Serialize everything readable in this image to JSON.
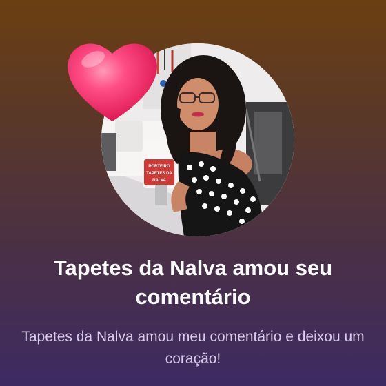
{
  "notification": {
    "title": "Tapetes da Nalva amou seu comentário",
    "message": "Tapetes da Nalva amou meu comentário e deixou um coração!"
  },
  "sewing_machine_sticker": {
    "line1": "PORTEIRO",
    "line2": "TAPETES DA",
    "line3": "NALVA"
  },
  "icons": {
    "reaction": "heart-icon"
  },
  "colors": {
    "background_top": "#6b3f12",
    "background_bottom": "#3e2a63",
    "heart": "#f2326f",
    "title_text": "#ffffff",
    "message_text": "#d9cbe9"
  }
}
